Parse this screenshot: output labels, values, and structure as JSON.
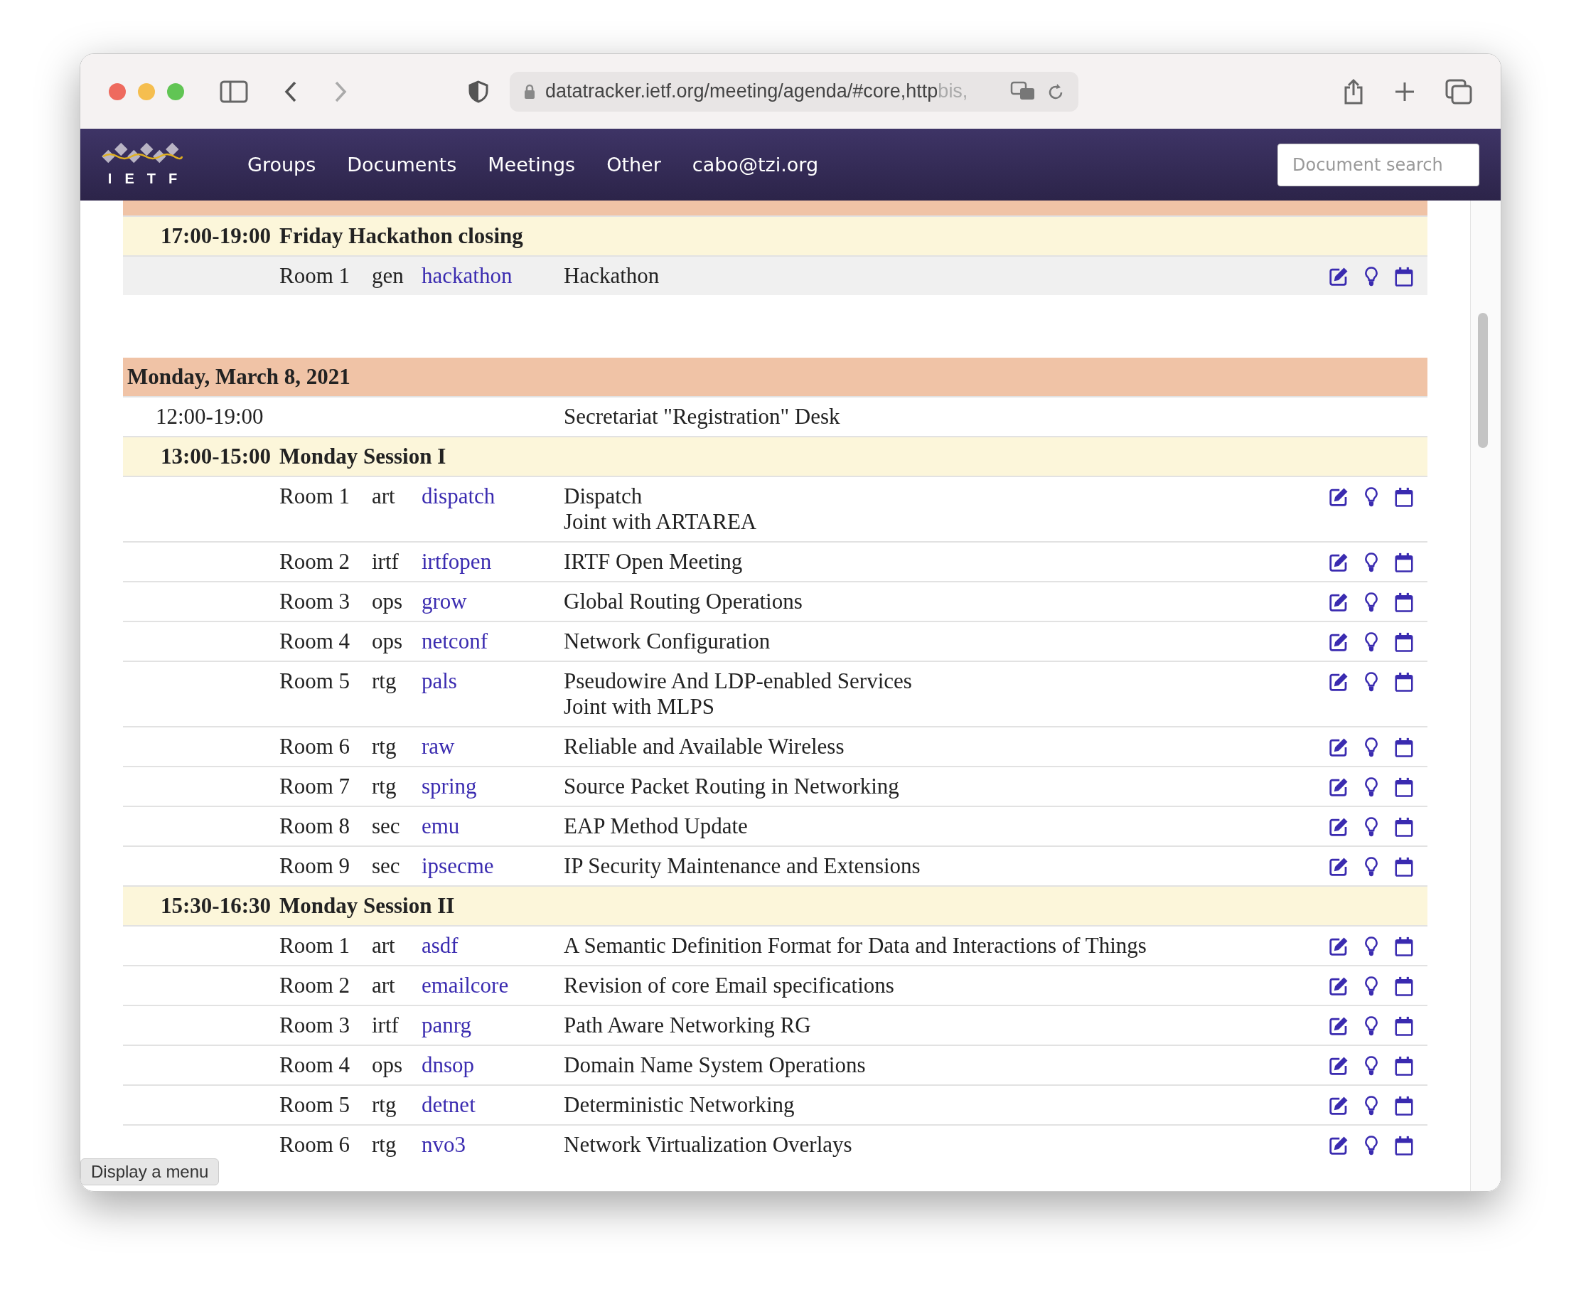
{
  "browser": {
    "url": "datatracker.ietf.org/meeting/agenda/#core,http",
    "url_faded": "bis,"
  },
  "nav": {
    "logo": "IETF",
    "items": [
      "Groups",
      "Documents",
      "Meetings",
      "Other",
      "cabo@tzi.org"
    ],
    "search": {
      "placeholder": "Document search"
    }
  },
  "agenda": [
    {
      "kind": "session",
      "time": "17:00-19:00",
      "title": "Friday Hackathon closing"
    },
    {
      "kind": "item",
      "room": "Room 1",
      "area": "gen",
      "group": "hackathon",
      "name": "Hackathon",
      "shaded": true
    },
    {
      "kind": "day",
      "title": "Monday, March 8, 2021"
    },
    {
      "kind": "info",
      "time": "12:00-19:00",
      "name": "Secretariat \"Registration\" Desk"
    },
    {
      "kind": "session",
      "time": "13:00-15:00",
      "title": "Monday Session I"
    },
    {
      "kind": "item",
      "room": "Room 1",
      "area": "art",
      "group": "dispatch",
      "name": "Dispatch",
      "note": "Joint with ARTAREA",
      "shaded": false
    },
    {
      "kind": "item",
      "room": "Room 2",
      "area": "irtf",
      "group": "irtfopen",
      "name": "IRTF Open Meeting",
      "shaded": false
    },
    {
      "kind": "item",
      "room": "Room 3",
      "area": "ops",
      "group": "grow",
      "name": "Global Routing Operations",
      "shaded": false
    },
    {
      "kind": "item",
      "room": "Room 4",
      "area": "ops",
      "group": "netconf",
      "name": "Network Configuration",
      "shaded": false
    },
    {
      "kind": "item",
      "room": "Room 5",
      "area": "rtg",
      "group": "pals",
      "name": "Pseudowire And LDP-enabled Services",
      "note": "Joint with MLPS",
      "shaded": false
    },
    {
      "kind": "item",
      "room": "Room 6",
      "area": "rtg",
      "group": "raw",
      "name": "Reliable and Available Wireless",
      "shaded": false
    },
    {
      "kind": "item",
      "room": "Room 7",
      "area": "rtg",
      "group": "spring",
      "name": "Source Packet Routing in Networking",
      "shaded": false
    },
    {
      "kind": "item",
      "room": "Room 8",
      "area": "sec",
      "group": "emu",
      "name": "EAP Method Update",
      "shaded": false
    },
    {
      "kind": "item",
      "room": "Room 9",
      "area": "sec",
      "group": "ipsecme",
      "name": "IP Security Maintenance and Extensions",
      "shaded": false
    },
    {
      "kind": "session",
      "time": "15:30-16:30",
      "title": "Monday Session II"
    },
    {
      "kind": "item",
      "room": "Room 1",
      "area": "art",
      "group": "asdf",
      "name": "A Semantic Definition Format for Data and Interactions of Things",
      "shaded": false
    },
    {
      "kind": "item",
      "room": "Room 2",
      "area": "art",
      "group": "emailcore",
      "name": "Revision of core Email specifications",
      "shaded": false
    },
    {
      "kind": "item",
      "room": "Room 3",
      "area": "irtf",
      "group": "panrg",
      "name": "Path Aware Networking RG",
      "shaded": false
    },
    {
      "kind": "item",
      "room": "Room 4",
      "area": "ops",
      "group": "dnsop",
      "name": "Domain Name System Operations",
      "shaded": false
    },
    {
      "kind": "item",
      "room": "Room 5",
      "area": "rtg",
      "group": "detnet",
      "name": "Deterministic Networking",
      "shaded": false
    },
    {
      "kind": "item",
      "room": "Room 6",
      "area": "rtg",
      "group": "nvo3",
      "name": "Network Virtualization Overlays",
      "shaded": false
    }
  ],
  "tooltip": "Display a menu"
}
